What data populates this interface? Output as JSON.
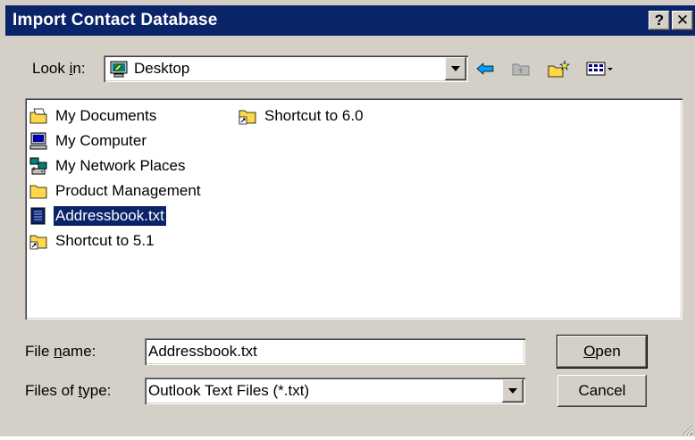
{
  "window": {
    "title": "Import Contact Database",
    "help_button": "?",
    "close_button": "✕"
  },
  "lookin": {
    "label_pre": "Look ",
    "label_acc": "i",
    "label_post": "n:",
    "value": "Desktop",
    "icon": "desktop-icon"
  },
  "toolbar": {
    "back_icon": "back-arrow-icon",
    "up_icon": "up-folder-icon",
    "new_folder_icon": "new-folder-icon",
    "view_icon": "view-menu-icon"
  },
  "files": [
    {
      "name": "My Documents",
      "icon": "my-documents-icon"
    },
    {
      "name": "My Computer",
      "icon": "my-computer-icon"
    },
    {
      "name": "My Network Places",
      "icon": "network-places-icon"
    },
    {
      "name": "Product Management",
      "icon": "folder-icon"
    },
    {
      "name": "Addressbook.txt",
      "icon": "text-file-icon",
      "selected": true
    },
    {
      "name": "Shortcut to 5.1",
      "icon": "shortcut-folder-icon"
    },
    {
      "name": "Shortcut to 6.0",
      "icon": "shortcut-folder-icon"
    }
  ],
  "filename": {
    "label_pre": "File ",
    "label_acc": "n",
    "label_post": "ame:",
    "value": "Addressbook.txt"
  },
  "filetype": {
    "label_pre": "Files of ",
    "label_acc": "t",
    "label_post": "ype:",
    "value": "Outlook Text Files (*.txt)"
  },
  "buttons": {
    "open_acc": "O",
    "open_rest": "pen",
    "cancel": "Cancel"
  },
  "colors": {
    "titlebar": "#0a246a",
    "face": "#d4d0c8",
    "selection": "#0a246a"
  }
}
